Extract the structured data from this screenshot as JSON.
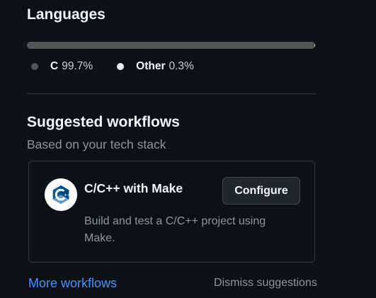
{
  "languages": {
    "title": "Languages",
    "items": [
      {
        "name": "C",
        "percent": "99.7%",
        "value": 99.7,
        "color": "#555555",
        "dot_color": "#555555"
      },
      {
        "name": "Other",
        "percent": "0.3%",
        "value": 0.3,
        "color": "#ededed",
        "dot_color": "#ededed"
      }
    ]
  },
  "workflows": {
    "title": "Suggested workflows",
    "subtitle": "Based on your tech stack",
    "card": {
      "icon": "cpp-logo-icon",
      "name": "C/C++ with Make",
      "configure_label": "Configure",
      "description": "Build and test a C/C++ project using Make."
    },
    "more_label": "More workflows",
    "dismiss_label": "Dismiss suggestions"
  },
  "colors": {
    "background": "#0d1117",
    "border": "#30363d",
    "link": "#4493f8",
    "muted": "#8b949e"
  }
}
